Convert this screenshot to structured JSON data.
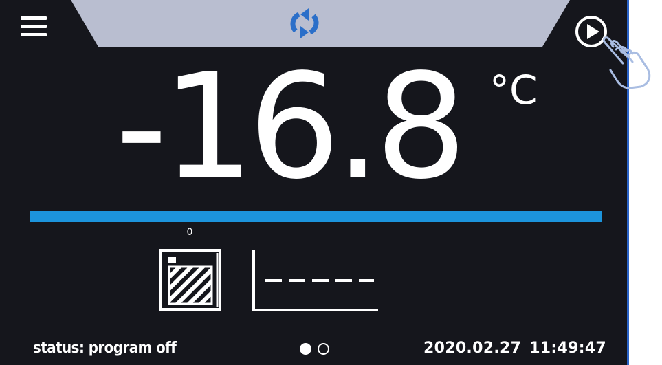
{
  "header": {
    "mode_icon": "sync-icon",
    "menu_icon": "hamburger-menu-icon",
    "start_icon": "play-icon",
    "pointer_icon": "hand-pointer-icon",
    "tab_color": "#b9bed0",
    "mode_icon_color": "#2b6fc9"
  },
  "reading": {
    "value": "-16.8",
    "unit": "°C"
  },
  "progress": {
    "label": "0",
    "fill_percent": 100,
    "color": "#1c94dc"
  },
  "icons": {
    "chamber": "chamber-icon",
    "graph": "graph-icon"
  },
  "footer": {
    "status": "status: program off",
    "date": "2020.02.27",
    "time": "11:49:47",
    "pages": 2,
    "active_page": 1
  }
}
